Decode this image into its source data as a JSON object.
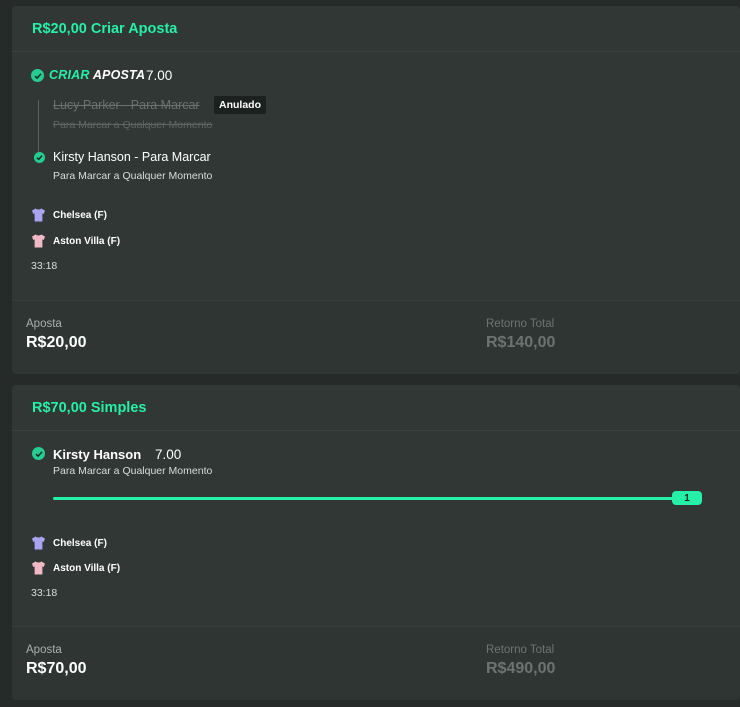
{
  "card1": {
    "title": "R$20,00 Criar Aposta",
    "bet_builder": {
      "logo_part1": "CRIAR",
      "logo_part2": "APOSTA",
      "odds": "7.00"
    },
    "void_selection": {
      "name": "Lucy Parker - Para Marcar",
      "market": "Para Marcar a Qualquer Momento",
      "badge": "Anulado"
    },
    "selection": {
      "name": "Kirsty Hanson - Para Marcar",
      "market": "Para Marcar a Qualquer Momento"
    },
    "home_team": "Chelsea (F)",
    "away_team": "Aston Villa (F)",
    "clock": "33:18",
    "stake_label": "Aposta",
    "stake_value": "R$20,00",
    "return_label": "Retorno Total",
    "return_value": "R$140,00"
  },
  "card2": {
    "title": "R$70,00 Simples",
    "selection": {
      "name": "Kirsty Hanson",
      "odds": "7.00",
      "market": "Para Marcar a Qualquer Momento"
    },
    "progress": {
      "fraction": 1.0,
      "label": "1"
    },
    "home_team": "Chelsea (F)",
    "away_team": "Aston Villa (F)",
    "clock": "33:18",
    "stake_label": "Aposta",
    "stake_value": "R$70,00",
    "return_label": "Retorno Total",
    "return_value": "R$490,00"
  },
  "colors": {
    "accent": "#26f0a8",
    "home_shirt": "#a9a3f0",
    "away_shirt": "#f2b8c4"
  },
  "icons": {
    "check": "check-circle-icon",
    "home_shirt": "shirt-icon",
    "away_shirt": "shirt-icon"
  }
}
